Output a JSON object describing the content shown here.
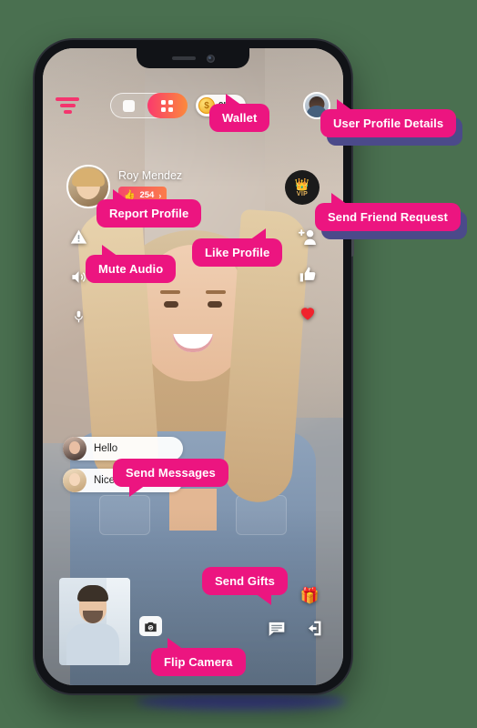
{
  "app": {
    "background_color": "#4a7050",
    "tooltip_color": "#ec1580",
    "tooltip_shadow_color": "#4b4a8a",
    "accent_gradient_from": "#fa3a6d",
    "accent_gradient_to": "#fb8a3c"
  },
  "topbar": {
    "filter_icon": "filter-icon",
    "view_toggle": {
      "single_view_label": "single-view",
      "grid_view_label": "grid-view",
      "selected": "grid-view"
    },
    "wallet": {
      "coin_symbol": "$",
      "amount": "9K +"
    },
    "profile_avatar": "user-avatar"
  },
  "profile": {
    "name": "Roy Mendez",
    "like_icon": "thumbs-up-icon",
    "like_count": "254",
    "chevron": "›",
    "vip_badge": {
      "crown": "♔",
      "label": "VIP"
    }
  },
  "left_controls": [
    {
      "name": "report-icon",
      "label": "Report"
    },
    {
      "name": "speaker-icon",
      "label": "Speaker"
    },
    {
      "name": "microphone-icon",
      "label": "Microphone"
    }
  ],
  "right_controls": [
    {
      "name": "add-friend-icon",
      "label": "Add Friend"
    },
    {
      "name": "thumbs-up-icon",
      "label": "Like"
    },
    {
      "name": "heart-icon",
      "label": "Favorite"
    }
  ],
  "messages": [
    {
      "avatar": "avatar-dark-hair",
      "text": "Hello"
    },
    {
      "avatar": "avatar-blonde",
      "text": "Nice to meet you"
    }
  ],
  "bottom_bar": {
    "self_view": "self-view-thumbnail",
    "flip_camera_icon": "camera-flip-icon",
    "gift_icon": "gift-icon",
    "chat_icon": "chat-icon",
    "exit_icon": "exit-icon"
  },
  "tooltips": {
    "wallet": "Wallet",
    "user_profile_details": "User Profile Details",
    "report_profile": "Report Profile",
    "send_friend_request": "Send Friend Request",
    "like_profile": "Like Profile",
    "mute_audio": "Mute Audio",
    "send_messages": "Send Messages",
    "send_gifts": "Send Gifts",
    "flip_camera": "Flip Camera"
  }
}
